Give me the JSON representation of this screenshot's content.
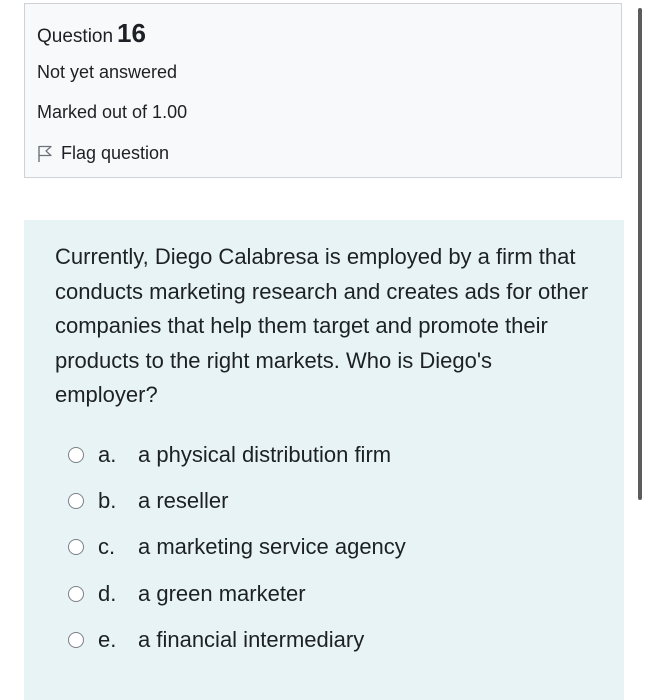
{
  "info": {
    "question_label": "Question",
    "question_number": "16",
    "state": "Not yet answered",
    "grade": "Marked out of 1.00",
    "flag_label": "Flag question",
    "flag_icon": "flag-outline-icon"
  },
  "question": {
    "text": "Currently, Diego Calabresa is employed by a firm that conducts marketing research and creates ads for other companies that help them target and promote their products to the right markets. Who is Diego's employer?"
  },
  "answers": [
    {
      "letter": "a.",
      "text": "a physical distribution firm",
      "selected": false
    },
    {
      "letter": "b.",
      "text": "a reseller",
      "selected": false
    },
    {
      "letter": "c.",
      "text": "a marketing service agency",
      "selected": false
    },
    {
      "letter": "d.",
      "text": "a green marketer",
      "selected": false
    },
    {
      "letter": "e.",
      "text": "a financial intermediary",
      "selected": false
    }
  ],
  "colors": {
    "info_background": "#f8f9fa",
    "info_border": "#cfd3d7",
    "question_background": "#e7f3f5",
    "text": "#1d2125"
  }
}
